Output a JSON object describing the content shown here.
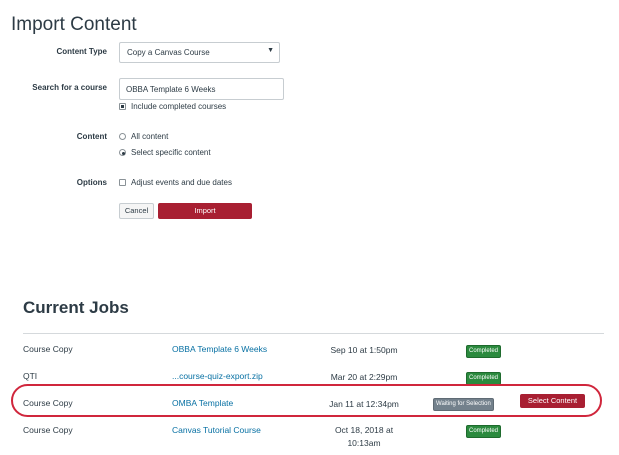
{
  "page": {
    "title": "Import Content"
  },
  "form": {
    "content_type": {
      "label": "Content Type",
      "value": "Copy a Canvas Course"
    },
    "search": {
      "label": "Search for a course",
      "value": "OBBA Template 6 Weeks",
      "include_completed": "Include completed courses"
    },
    "content": {
      "label": "Content",
      "option_all": "All content",
      "option_specific": "Select specific content"
    },
    "options": {
      "label": "Options",
      "adjust_dates": "Adjust events and due dates"
    },
    "cancel_label": "Cancel",
    "import_label": "Import"
  },
  "jobs": {
    "title": "Current Jobs",
    "rows": [
      {
        "type": "Course Copy",
        "name": "OBBA Template 6 Weeks",
        "date": "Sep 10 at 1:50pm",
        "status": "Completed"
      },
      {
        "type": "QTI",
        "name": "...course-quiz-export.zip",
        "date": "Mar 20 at 2:29pm",
        "status": "Completed"
      },
      {
        "type": "Course Copy",
        "name": "OMBA Template",
        "date": "Jan 11 at 12:34pm",
        "status": "Waiting for Selection",
        "action": "Select Content"
      },
      {
        "type": "Course Copy",
        "name": "Canvas Tutorial Course",
        "date_line1": "Oct 18, 2018 at",
        "date_line2": "10:13am",
        "status": "Completed"
      }
    ]
  },
  "colors": {
    "primary": "#a81f32",
    "link": "#0770a3",
    "success": "#2b8a3e",
    "waiting": "#73818c",
    "highlight": "#d0263c"
  }
}
